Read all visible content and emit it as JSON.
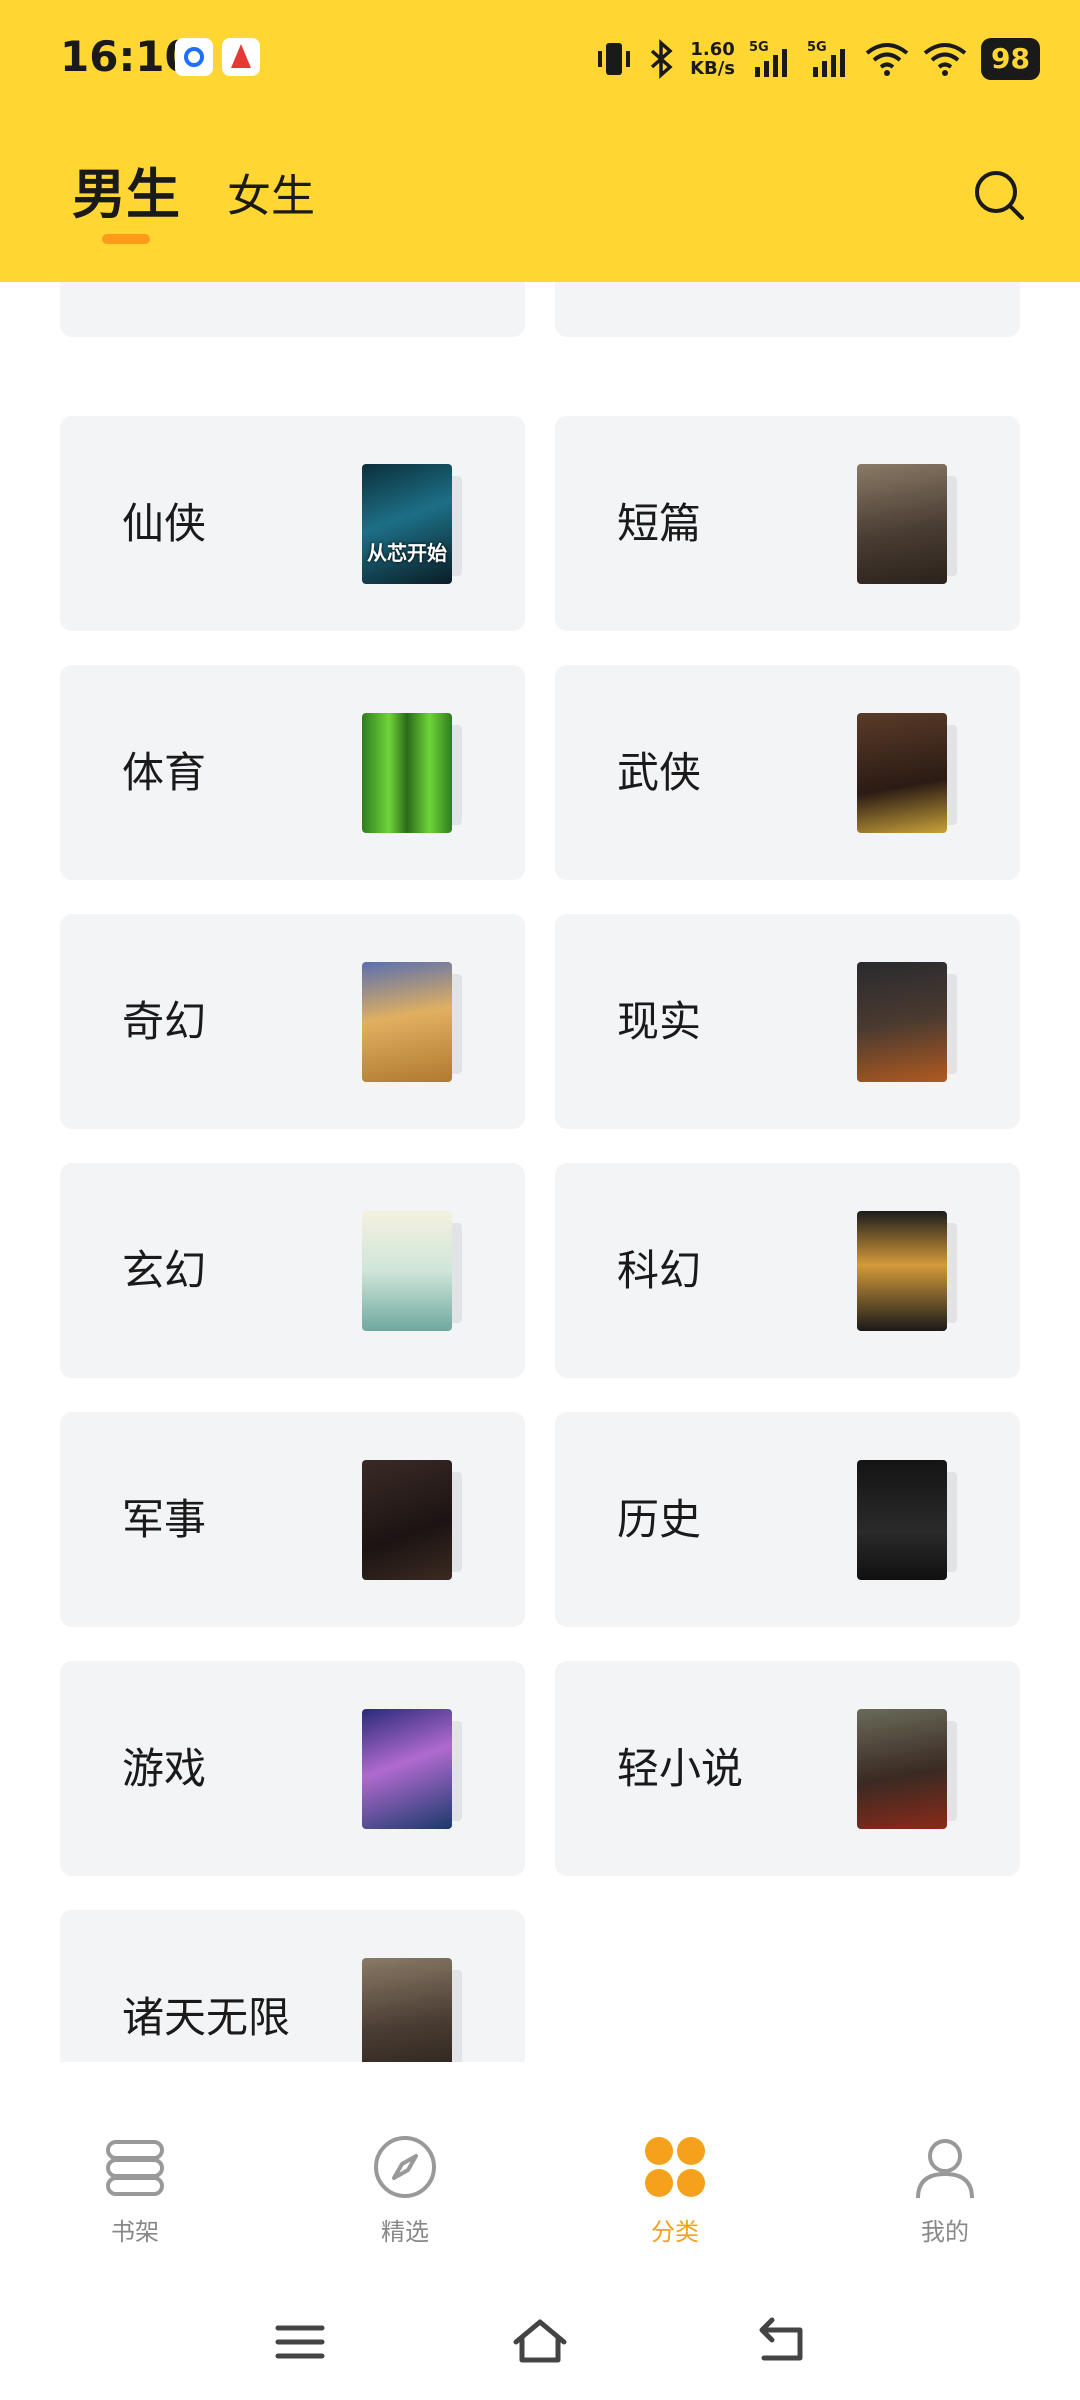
{
  "status_bar": {
    "time": "16:10",
    "net_speed_value": "1.60",
    "net_speed_unit": "KB/s",
    "sim1": "5G",
    "sim2": "5G",
    "battery": "98"
  },
  "header": {
    "tab_male": "男生",
    "tab_female": "女生",
    "accent_color": "#FFD632",
    "indicator_color": "#FF9A1A"
  },
  "categories": [
    {
      "label": "仙侠",
      "cover_title": "从芯开始"
    },
    {
      "label": "短篇",
      "cover_title": ""
    },
    {
      "label": "体育",
      "cover_title": ""
    },
    {
      "label": "武侠",
      "cover_title": ""
    },
    {
      "label": "奇幻",
      "cover_title": ""
    },
    {
      "label": "现实",
      "cover_title": ""
    },
    {
      "label": "玄幻",
      "cover_title": ""
    },
    {
      "label": "科幻",
      "cover_title": ""
    },
    {
      "label": "军事",
      "cover_title": ""
    },
    {
      "label": "历史",
      "cover_title": ""
    },
    {
      "label": "游戏",
      "cover_title": ""
    },
    {
      "label": "轻小说",
      "cover_title": ""
    },
    {
      "label": "诸天无限",
      "cover_title": ""
    }
  ],
  "bottom_nav": [
    {
      "label": "书架",
      "icon": "bookshelf-icon"
    },
    {
      "label": "精选",
      "icon": "compass-icon"
    },
    {
      "label": "分类",
      "icon": "category-icon",
      "active": true
    },
    {
      "label": "我的",
      "icon": "profile-icon"
    }
  ],
  "active_color": "#F5A11B"
}
